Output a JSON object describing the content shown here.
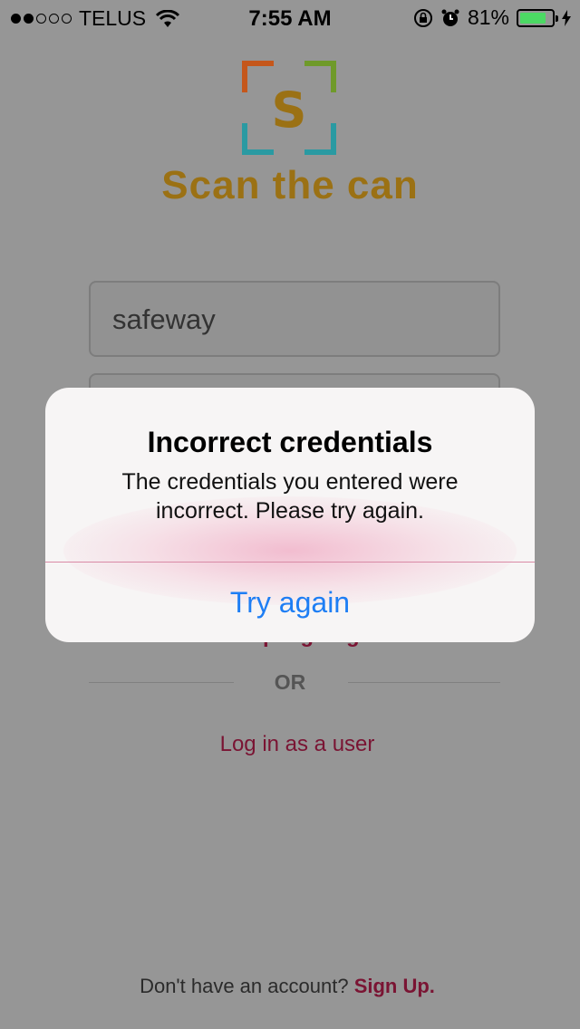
{
  "status_bar": {
    "carrier": "TELUS",
    "time": "7:55 AM",
    "battery_percent": "81%",
    "battery_level": 0.81,
    "icons": [
      "signal-dots",
      "wifi-icon",
      "rotation-lock-icon",
      "alarm-icon",
      "battery-icon",
      "charging-bolt-icon"
    ]
  },
  "brand": {
    "logo_letter": "S",
    "name": "Scan the can",
    "colors": {
      "orange": "#c5571b",
      "green": "#6f9a2a",
      "teal": "#2a9aa2",
      "gold": "#9b7114"
    }
  },
  "form": {
    "username_value": "safeway",
    "help_link": "Get help signing in."
  },
  "divider_text": "OR",
  "user_login_link": "Log in as a user",
  "signup": {
    "prompt": "Don't have an account?",
    "link": "Sign Up."
  },
  "alert": {
    "title": "Incorrect credentials",
    "message": "The credentials you entered were incorrect. Please try again.",
    "button": "Try again"
  }
}
